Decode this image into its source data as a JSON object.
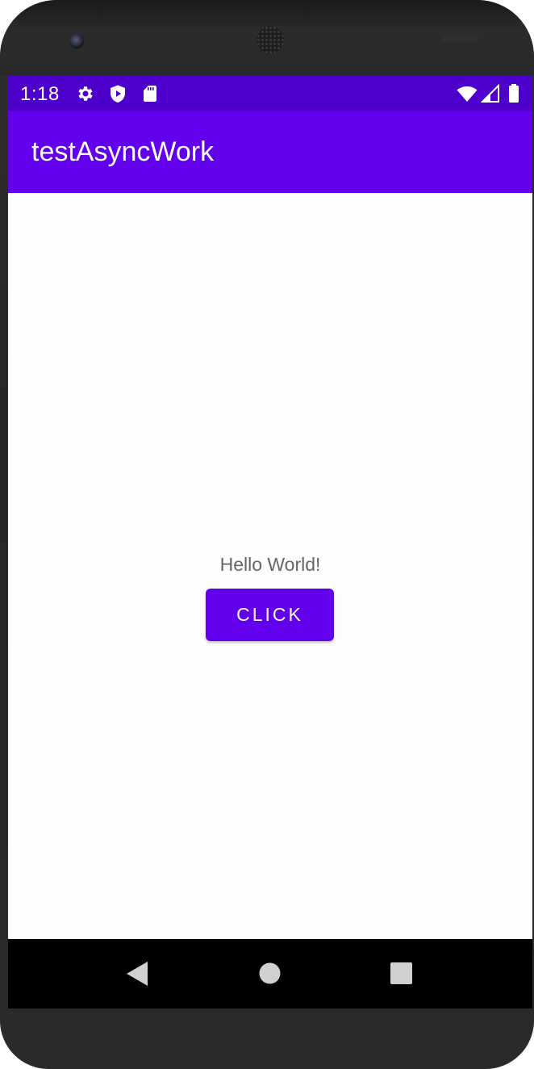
{
  "status_bar": {
    "time": "1:18",
    "background": "#4d00cc",
    "left_icons": [
      "settings-icon",
      "play-protect-icon",
      "sd-card-icon"
    ],
    "right_icons": [
      "wifi-icon",
      "cell-signal-icon",
      "battery-icon"
    ]
  },
  "app_bar": {
    "title": "testAsyncWork",
    "background": "#6200ee"
  },
  "main": {
    "hello_text": "Hello World!",
    "button_label": "CLICK",
    "button_color": "#6200ee"
  },
  "nav_bar": {
    "buttons": [
      "back-icon",
      "home-icon",
      "recents-icon"
    ]
  }
}
